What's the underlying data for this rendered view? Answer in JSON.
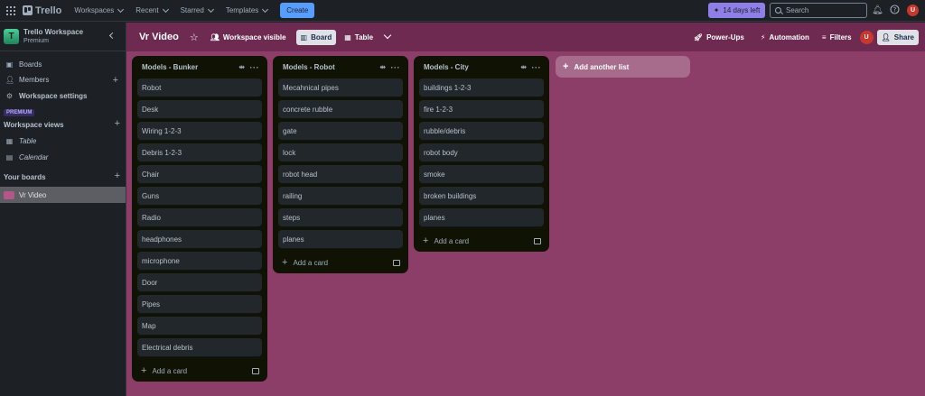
{
  "topnav": {
    "logo_text": "Trello",
    "menus": [
      "Workspaces",
      "Recent",
      "Starred",
      "Templates"
    ],
    "create_label": "Create",
    "trial_label": "14 days left",
    "search_placeholder": "Search",
    "avatar_initial": "U",
    "colors": {
      "create": "#579dff",
      "trial": "#8f7ee7",
      "avatar": "#c9372c"
    }
  },
  "sidebar": {
    "workspace_initial": "T",
    "workspace_name": "Trello Workspace",
    "workspace_plan": "Premium",
    "items": [
      {
        "label": "Boards",
        "icon": "board-icon"
      },
      {
        "label": "Members",
        "icon": "members-icon"
      },
      {
        "label": "Workspace settings",
        "icon": "gear-icon"
      }
    ],
    "premium_badge": "PREMIUM",
    "views_title": "Workspace views",
    "views": [
      {
        "label": "Table",
        "icon": "table-icon"
      },
      {
        "label": "Calendar",
        "icon": "calendar-icon"
      }
    ],
    "boards_title": "Your boards",
    "boards": [
      {
        "label": "Vr Video",
        "color": "#b3568a"
      }
    ]
  },
  "board": {
    "title": "Vr Video",
    "visibility_label": "Workspace visible",
    "view_board_label": "Board",
    "view_table_label": "Table",
    "powerups_label": "Power-Ups",
    "automation_label": "Automation",
    "filters_label": "Filters",
    "share_label": "Share",
    "add_list_label": "Add another list",
    "add_card_label": "Add a card",
    "background_color": "#8c3d68",
    "lists": [
      {
        "title": "Models - Bunker",
        "cards": [
          "Robot",
          "Desk",
          "Wiring 1-2-3",
          "Debris 1-2-3",
          "Chair",
          "Guns",
          "Radio",
          "headphones",
          "microphone",
          "Door",
          "Pipes",
          "Map",
          "Electrical debris"
        ]
      },
      {
        "title": "Models - Robot",
        "cards": [
          "Mecahnical pipes",
          "concrete rubble",
          "gate",
          "lock",
          "robot head",
          "railing",
          "steps",
          "planes"
        ]
      },
      {
        "title": "Models - City",
        "cards": [
          "buildings 1-2-3",
          "fire 1-2-3",
          "rubble/debris",
          "robot body",
          "smoke",
          "broken buildings",
          "planes"
        ]
      }
    ]
  }
}
